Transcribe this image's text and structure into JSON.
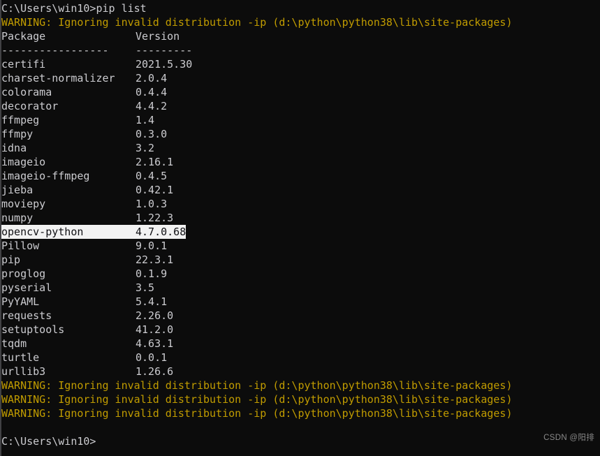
{
  "terminal": {
    "background_color": "#0c0c0c",
    "text_color": "#ccccd0",
    "warning_color": "#c19c00",
    "selection_bg_color": "#f2f2f2",
    "selection_fg_color": "#101014",
    "prompt_command": "C:\\Users\\win10>pip list",
    "top_warning": "WARNING: Ignoring invalid distribution -ip (d:\\python\\python38\\lib\\site-packages)",
    "header_package": "Package",
    "header_version": "Version",
    "separator_package": "-----------------",
    "separator_version": "---------",
    "packages": [
      {
        "name": "certifi",
        "version": "2021.5.30",
        "selected": false
      },
      {
        "name": "charset-normalizer",
        "version": "2.0.4",
        "selected": false
      },
      {
        "name": "colorama",
        "version": "0.4.4",
        "selected": false
      },
      {
        "name": "decorator",
        "version": "4.4.2",
        "selected": false
      },
      {
        "name": "ffmpeg",
        "version": "1.4",
        "selected": false
      },
      {
        "name": "ffmpy",
        "version": "0.3.0",
        "selected": false
      },
      {
        "name": "idna",
        "version": "3.2",
        "selected": false
      },
      {
        "name": "imageio",
        "version": "2.16.1",
        "selected": false
      },
      {
        "name": "imageio-ffmpeg",
        "version": "0.4.5",
        "selected": false
      },
      {
        "name": "jieba",
        "version": "0.42.1",
        "selected": false
      },
      {
        "name": "moviepy",
        "version": "1.0.3",
        "selected": false
      },
      {
        "name": "numpy",
        "version": "1.22.3",
        "selected": false
      },
      {
        "name": "opencv-python",
        "version": "4.7.0.68",
        "selected": true
      },
      {
        "name": "Pillow",
        "version": "9.0.1",
        "selected": false
      },
      {
        "name": "pip",
        "version": "22.3.1",
        "selected": false
      },
      {
        "name": "proglog",
        "version": "0.1.9",
        "selected": false
      },
      {
        "name": "pyserial",
        "version": "3.5",
        "selected": false
      },
      {
        "name": "PyYAML",
        "version": "5.4.1",
        "selected": false
      },
      {
        "name": "requests",
        "version": "2.26.0",
        "selected": false
      },
      {
        "name": "setuptools",
        "version": "41.2.0",
        "selected": false
      },
      {
        "name": "tqdm",
        "version": "4.63.1",
        "selected": false
      },
      {
        "name": "turtle",
        "version": "0.0.1",
        "selected": false
      },
      {
        "name": "urllib3",
        "version": "1.26.6",
        "selected": false
      }
    ],
    "bottom_warnings": [
      "WARNING: Ignoring invalid distribution -ip (d:\\python\\python38\\lib\\site-packages)",
      "WARNING: Ignoring invalid distribution -ip (d:\\python\\python38\\lib\\site-packages)",
      "WARNING: Ignoring invalid distribution -ip (d:\\python\\python38\\lib\\site-packages)"
    ],
    "final_prompt": "C:\\Users\\win10>"
  },
  "watermark": {
    "text": "CSDN @阳排"
  }
}
